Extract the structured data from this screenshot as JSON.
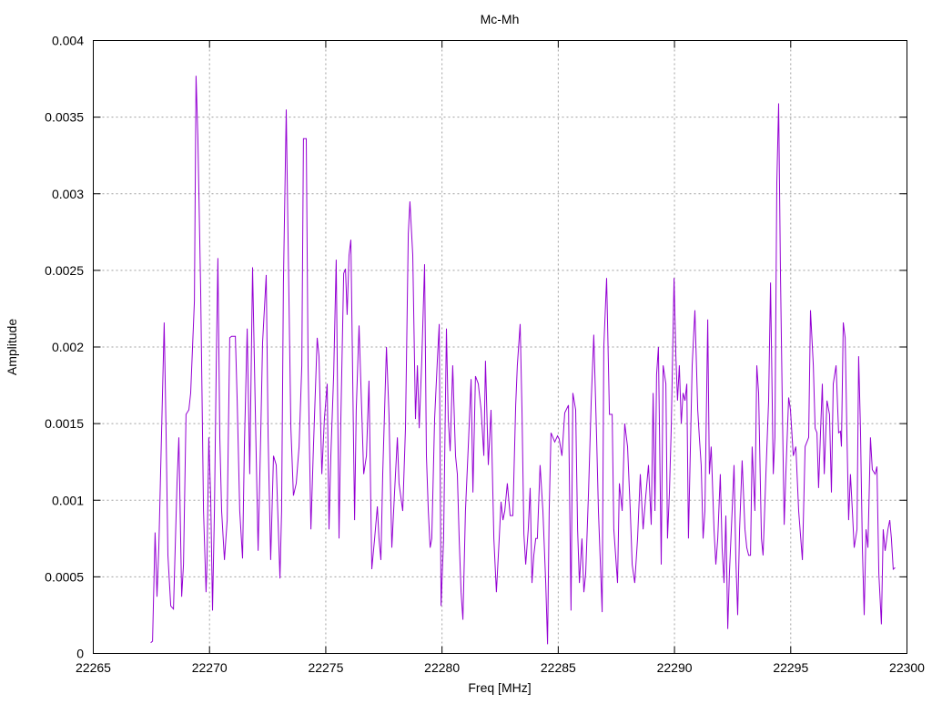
{
  "chart_data": {
    "type": "line",
    "title": "Mc-Mh",
    "xlabel": "Freq [MHz]",
    "ylabel": "Amplitude",
    "xlim": [
      22265,
      22300
    ],
    "ylim": [
      0,
      0.004
    ],
    "xticks": [
      "22265",
      "22270",
      "22275",
      "22280",
      "22285",
      "22290",
      "22295",
      "22300"
    ],
    "yticks": [
      "0",
      "0.0005",
      "0.001",
      "0.0015",
      "0.002",
      "0.0025",
      "0.003",
      "0.0035",
      "0.004"
    ],
    "grid": true,
    "legend": "none",
    "series_color": "#9400d3",
    "series": [
      {
        "name": "Mc-Mh",
        "x": [
          22267.47,
          22267.55,
          22267.66,
          22267.74,
          22267.82,
          22268.05,
          22268.13,
          22268.21,
          22268.33,
          22268.45,
          22268.6,
          22268.68,
          22268.8,
          22268.88,
          22268.99,
          22269.11,
          22269.19,
          22269.35,
          22269.42,
          22269.5,
          22269.62,
          22269.74,
          22269.85,
          22269.89,
          22269.97,
          22270.05,
          22270.13,
          22270.21,
          22270.29,
          22270.36,
          22270.44,
          22270.52,
          22270.64,
          22270.76,
          22270.87,
          22270.95,
          22271.11,
          22271.19,
          22271.3,
          22271.42,
          22271.5,
          22271.62,
          22271.73,
          22271.85,
          22271.97,
          22272.09,
          22272.2,
          22272.28,
          22272.44,
          22272.52,
          22272.63,
          22272.75,
          22272.87,
          22273.03,
          22273.1,
          22273.18,
          22273.3,
          22273.38,
          22273.5,
          22273.61,
          22273.73,
          22273.85,
          22273.97,
          22274.04,
          22274.16,
          22274.24,
          22274.36,
          22274.47,
          22274.63,
          22274.71,
          22274.83,
          22274.94,
          22275.06,
          22275.14,
          22275.22,
          22275.34,
          22275.45,
          22275.57,
          22275.65,
          22275.77,
          22275.85,
          22275.92,
          22276.0,
          22276.08,
          22276.16,
          22276.24,
          22276.31,
          22276.43,
          22276.51,
          22276.63,
          22276.75,
          22276.86,
          22276.98,
          22277.1,
          22277.22,
          22277.29,
          22277.37,
          22277.45,
          22277.61,
          22277.72,
          22277.84,
          22277.96,
          22278.08,
          22278.15,
          22278.31,
          22278.43,
          22278.55,
          22278.62,
          22278.74,
          22278.86,
          22278.94,
          22279.02,
          22279.13,
          22279.25,
          22279.33,
          22279.41,
          22279.49,
          22279.56,
          22279.68,
          22279.8,
          22279.88,
          22279.96,
          22280.07,
          22280.19,
          22280.27,
          22280.35,
          22280.46,
          22280.58,
          22280.66,
          22280.74,
          22280.82,
          22280.9,
          22281.01,
          22281.13,
          22281.25,
          22281.33,
          22281.44,
          22281.56,
          22281.68,
          22281.8,
          22281.87,
          22281.99,
          22282.11,
          22282.23,
          22282.34,
          22282.46,
          22282.54,
          22282.62,
          22282.7,
          22282.81,
          22282.93,
          22283.05,
          22283.17,
          22283.24,
          22283.36,
          22283.44,
          22283.52,
          22283.6,
          22283.71,
          22283.79,
          22283.87,
          22283.95,
          22284.03,
          22284.1,
          22284.22,
          22284.34,
          22284.46,
          22284.54,
          22284.61,
          22284.69,
          22284.85,
          22284.97,
          22285.04,
          22285.16,
          22285.28,
          22285.44,
          22285.55,
          22285.63,
          22285.75,
          22285.83,
          22285.91,
          22286.02,
          22286.1,
          22286.18,
          22286.3,
          22286.42,
          22286.53,
          22286.65,
          22286.73,
          22286.89,
          22286.96,
          22287.08,
          22287.2,
          22287.32,
          22287.39,
          22287.55,
          22287.63,
          22287.75,
          22287.86,
          22287.98,
          22288.1,
          22288.18,
          22288.29,
          22288.41,
          22288.53,
          22288.65,
          22288.76,
          22288.88,
          22289.0,
          22289.08,
          22289.16,
          22289.23,
          22289.31,
          22289.43,
          22289.51,
          22289.63,
          22289.7,
          22289.78,
          22289.86,
          22289.98,
          22290.06,
          22290.13,
          22290.21,
          22290.29,
          22290.37,
          22290.45,
          22290.53,
          22290.6,
          22290.76,
          22290.88,
          22291.0,
          22291.07,
          22291.15,
          22291.23,
          22291.31,
          22291.43,
          22291.5,
          22291.58,
          22291.7,
          22291.78,
          22291.86,
          22291.97,
          22292.05,
          22292.13,
          22292.21,
          22292.29,
          22292.36,
          22292.48,
          22292.56,
          22292.64,
          22292.72,
          22292.8,
          22292.91,
          22293.03,
          22293.11,
          22293.19,
          22293.27,
          22293.34,
          22293.46,
          22293.54,
          22293.62,
          22293.74,
          22293.81,
          22293.93,
          22294.05,
          22294.13,
          22294.25,
          22294.32,
          22294.4,
          22294.48,
          22294.56,
          22294.64,
          22294.72,
          22294.79,
          22294.91,
          22294.99,
          22295.11,
          22295.22,
          22295.34,
          22295.5,
          22295.62,
          22295.77,
          22295.85,
          22295.97,
          22296.05,
          22296.13,
          22296.2,
          22296.28,
          22296.36,
          22296.44,
          22296.56,
          22296.67,
          22296.75,
          22296.83,
          22296.95,
          22297.06,
          22297.14,
          22297.18,
          22297.26,
          22297.34,
          22297.42,
          22297.49,
          22297.57,
          22297.65,
          22297.73,
          22297.85,
          22297.92,
          22298.0,
          22298.08,
          22298.16,
          22298.24,
          22298.32,
          22298.43,
          22298.51,
          22298.63,
          22298.71,
          22298.79,
          22298.9,
          22298.98,
          22299.06,
          22299.18,
          22299.26,
          22299.33,
          22299.41,
          22299.49
        ],
        "y": [
          7e-05,
          8e-05,
          0.00079,
          0.00037,
          0.00069,
          0.00216,
          0.00147,
          0.00064,
          0.00031,
          0.00029,
          0.00111,
          0.00141,
          0.00037,
          0.00058,
          0.00156,
          0.00159,
          0.0017,
          0.0023,
          0.00377,
          0.00337,
          0.00236,
          0.00093,
          0.0004,
          0.00058,
          0.00141,
          0.00102,
          0.00028,
          0.00093,
          0.00188,
          0.00258,
          0.00141,
          0.00093,
          0.00061,
          0.00087,
          0.00206,
          0.00207,
          0.00207,
          0.00165,
          0.00093,
          0.00062,
          0.00135,
          0.00212,
          0.00117,
          0.00252,
          0.00159,
          0.00067,
          0.00141,
          0.00203,
          0.00247,
          0.00141,
          0.00061,
          0.00129,
          0.00123,
          0.00049,
          0.00093,
          0.00242,
          0.00355,
          0.00271,
          0.00147,
          0.00103,
          0.00111,
          0.00135,
          0.00188,
          0.00336,
          0.00336,
          0.00188,
          0.00081,
          0.00135,
          0.00206,
          0.00194,
          0.00117,
          0.00153,
          0.00176,
          0.00081,
          0.00129,
          0.00182,
          0.00257,
          0.00075,
          0.00153,
          0.00248,
          0.00251,
          0.00221,
          0.0026,
          0.0027,
          0.00176,
          0.00087,
          0.00159,
          0.00214,
          0.00176,
          0.00117,
          0.00129,
          0.00178,
          0.00055,
          0.00075,
          0.00096,
          0.00075,
          0.00061,
          0.00117,
          0.002,
          0.00156,
          0.00069,
          0.00105,
          0.00141,
          0.00111,
          0.00093,
          0.00147,
          0.00274,
          0.00295,
          0.0026,
          0.00153,
          0.00188,
          0.00147,
          0.00191,
          0.00254,
          0.00129,
          0.00093,
          0.00069,
          0.00075,
          0.00153,
          0.00191,
          0.00215,
          0.00031,
          0.00075,
          0.00212,
          0.00153,
          0.00132,
          0.00188,
          0.00129,
          0.00117,
          0.00075,
          0.0004,
          0.00022,
          0.00093,
          0.00135,
          0.00179,
          0.00105,
          0.00181,
          0.00176,
          0.00159,
          0.00129,
          0.00191,
          0.00123,
          0.00159,
          0.00075,
          0.0004,
          0.00075,
          0.00099,
          0.00087,
          0.00093,
          0.00111,
          0.0009,
          0.0009,
          0.00162,
          0.00188,
          0.00215,
          0.00159,
          0.00078,
          0.00058,
          0.00081,
          0.00108,
          0.00046,
          0.00064,
          0.00075,
          0.00075,
          0.00123,
          0.00093,
          0.00046,
          6e-05,
          0.00093,
          0.00144,
          0.00138,
          0.00142,
          0.0014,
          0.00129,
          0.00157,
          0.00162,
          0.00028,
          0.0017,
          0.00159,
          0.00081,
          0.00046,
          0.00075,
          0.0004,
          0.00052,
          0.00105,
          0.00165,
          0.00208,
          0.00141,
          0.00093,
          0.00027,
          0.002,
          0.00245,
          0.00156,
          0.00156,
          0.00081,
          0.00046,
          0.00111,
          0.00093,
          0.0015,
          0.00135,
          0.00093,
          0.00058,
          0.00046,
          0.00075,
          0.00117,
          0.00081,
          0.00102,
          0.00123,
          0.00084,
          0.0017,
          0.00093,
          0.00182,
          0.002,
          0.00058,
          0.00188,
          0.00176,
          0.00075,
          0.00105,
          0.00147,
          0.00245,
          0.00194,
          0.00165,
          0.00188,
          0.0015,
          0.0017,
          0.00165,
          0.00176,
          0.00075,
          0.00188,
          0.00224,
          0.00159,
          0.00141,
          0.00123,
          0.00075,
          0.00093,
          0.00218,
          0.00117,
          0.00135,
          0.00081,
          0.00058,
          0.00075,
          0.00117,
          0.00069,
          0.00046,
          0.0009,
          0.00016,
          0.00052,
          0.00093,
          0.00123,
          0.00061,
          0.00025,
          0.00081,
          0.00126,
          0.00081,
          0.00069,
          0.00064,
          0.00064,
          0.00135,
          0.00093,
          0.00188,
          0.0017,
          0.00075,
          0.00064,
          0.00117,
          0.00165,
          0.00242,
          0.00117,
          0.00141,
          0.00307,
          0.00359,
          0.00248,
          0.00159,
          0.00084,
          0.00117,
          0.00167,
          0.00159,
          0.00129,
          0.00135,
          0.00093,
          0.00061,
          0.00135,
          0.00141,
          0.00224,
          0.00188,
          0.00147,
          0.00144,
          0.00108,
          0.00144,
          0.00176,
          0.00117,
          0.00165,
          0.00156,
          0.00105,
          0.00176,
          0.00188,
          0.00144,
          0.00145,
          0.00135,
          0.00216,
          0.00206,
          0.00141,
          0.00087,
          0.00117,
          0.00093,
          0.00069,
          0.00081,
          0.00194,
          0.00147,
          0.00069,
          0.00025,
          0.00081,
          0.00069,
          0.00141,
          0.0012,
          0.00117,
          0.00122,
          0.00052,
          0.00019,
          0.00081,
          0.00067,
          0.00081,
          0.00087,
          0.00075,
          0.00055,
          0.00056
        ]
      }
    ]
  }
}
